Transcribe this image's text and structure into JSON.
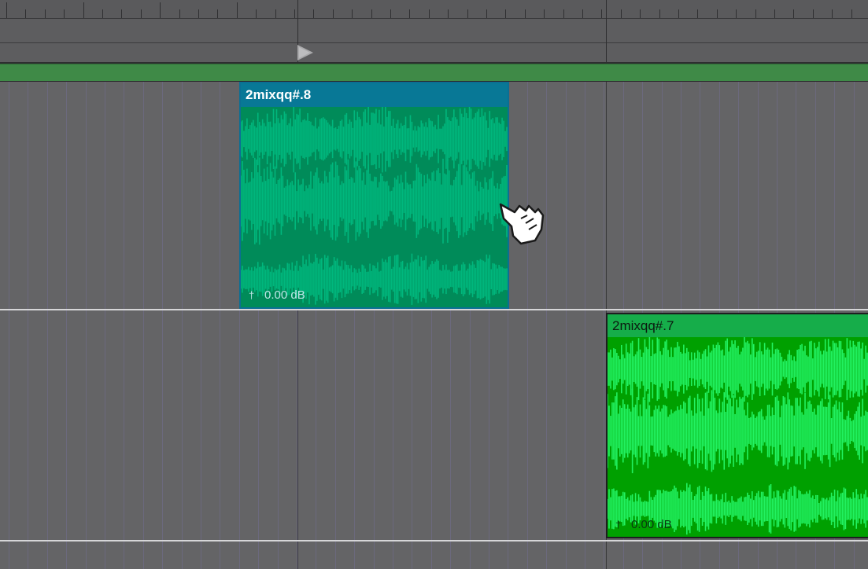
{
  "timeline": {
    "playhead_icon": "playhead-triangle-icon",
    "loop_bar_color": "#3f8a47"
  },
  "regions": [
    {
      "name": "2mixqq#.8",
      "gain": "0.00 dB",
      "gain_icon": "dagger-icon",
      "state": "selected",
      "color": "#0a7fa5",
      "waveform_color": "#00b77d",
      "waveform_fill": "#008b59"
    },
    {
      "name": "2mixqq#.7",
      "gain": "0.00 dB",
      "gain_icon": "dagger-icon",
      "state": "normal",
      "color": "#0aa30a",
      "waveform_color": "#22f262",
      "waveform_fill": "#00a000"
    }
  ],
  "cursor": {
    "icon": "pointing-hand-cursor-icon"
  }
}
